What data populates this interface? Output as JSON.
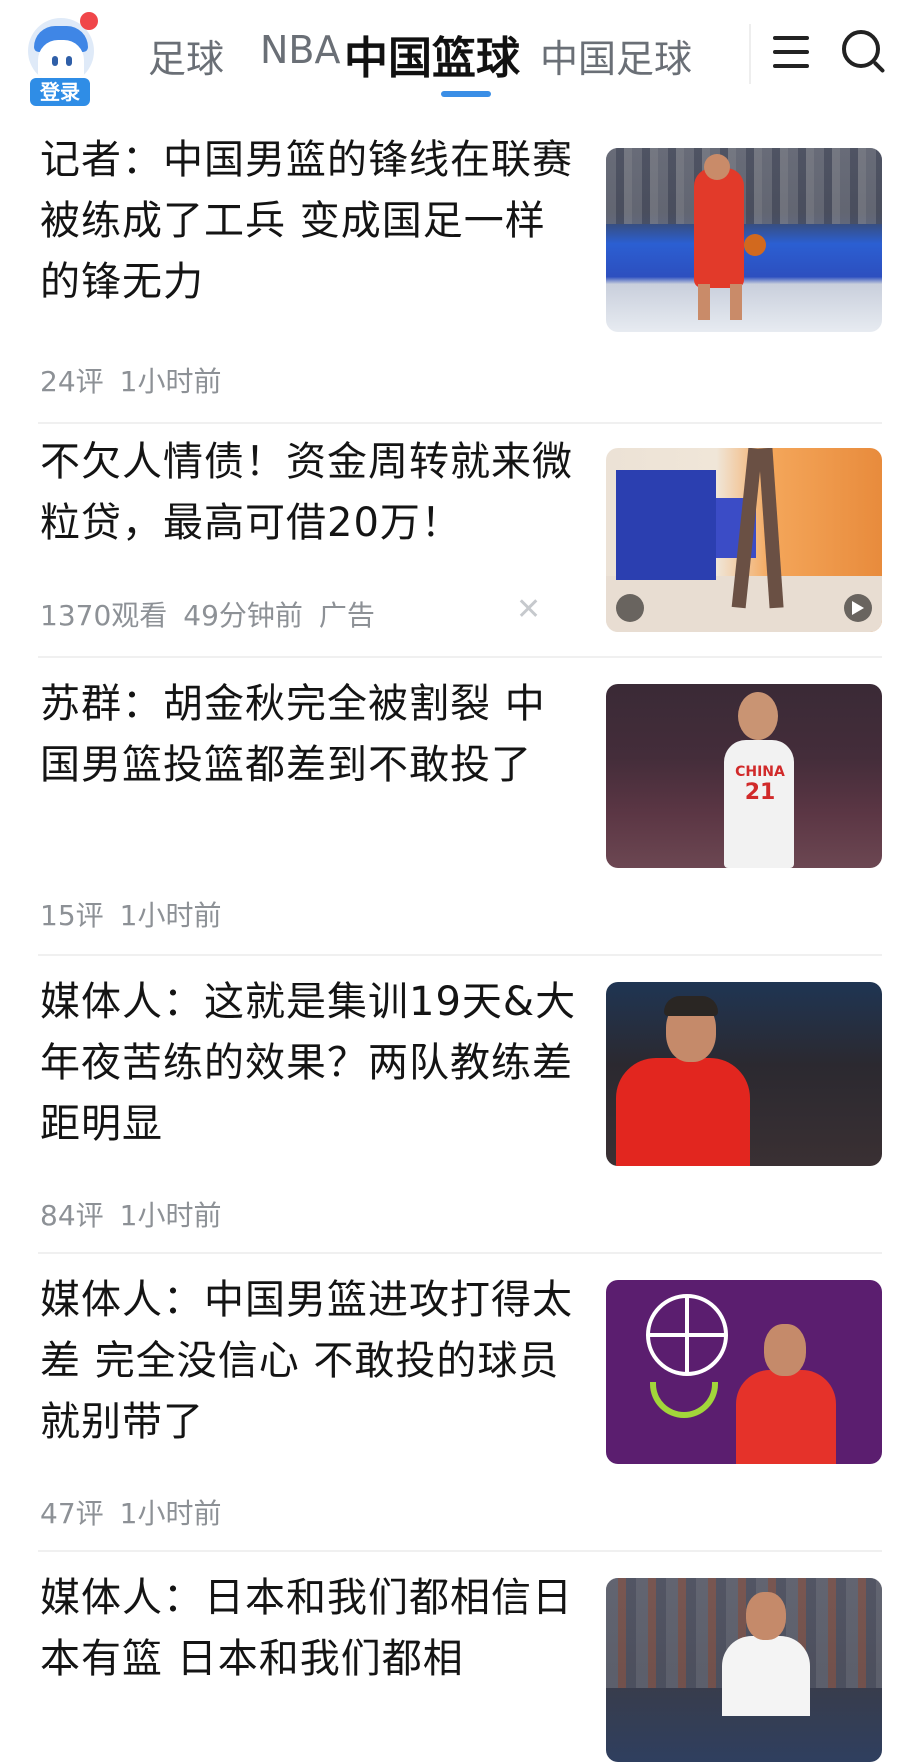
{
  "header": {
    "login_label": "登录",
    "tabs": [
      "足球",
      "NBA",
      "中国篮球",
      "中国足球"
    ],
    "active_tab": "中国篮球",
    "accent_color": "#3a8ee6"
  },
  "feed": [
    {
      "title": "记者：中国男篮的锋线在联赛被练成了工兵 变成国足一样的锋无力",
      "comments": "24评",
      "time": "1小时前",
      "image": "basketball-player-dribbling"
    },
    {
      "title": "不欠人情债！资金周转就来微粒贷，最高可借20万！",
      "views": "1370观看",
      "time": "49分钟前",
      "ad_label": "广告",
      "close_icon": "close-icon",
      "image": "video-ad-office"
    },
    {
      "title": "苏群：胡金秋完全被割裂 中国男篮投篮都差到不敢投了",
      "comments": "15评",
      "time": "1小时前",
      "image": "player-china-jersey",
      "jersey_text": "CHINA",
      "jersey_number": "21"
    },
    {
      "title": "媒体人：这就是集训19天&大年夜苦练的效果？两队教练差距明显",
      "comments": "84评",
      "time": "1小时前",
      "image": "coach-red-shirt"
    },
    {
      "title": "媒体人：中国男篮进攻打得太差 完全没信心 不敢投的球员就别带了",
      "comments": "47评",
      "time": "1小时前",
      "image": "coach-clapping"
    },
    {
      "title": "媒体人：日本和我们都相信日本有篮 日本和我们都相",
      "image": "coach-pointing"
    }
  ]
}
